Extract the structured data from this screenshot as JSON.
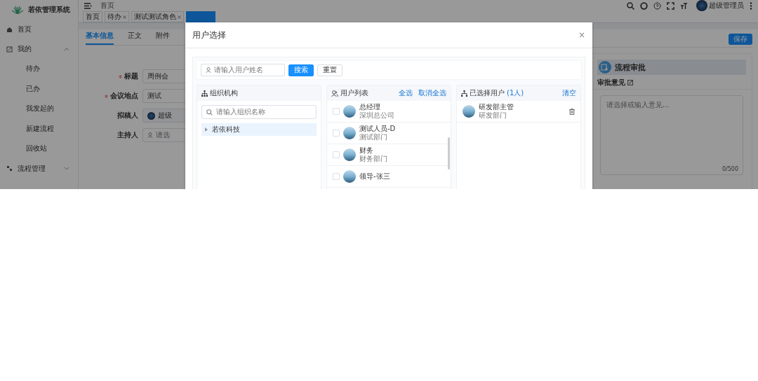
{
  "app": {
    "title": "若依管理系统"
  },
  "sidebar": {
    "items": [
      {
        "label": "首页"
      },
      {
        "label": "我的",
        "expanded": true,
        "children": [
          {
            "label": "待办"
          },
          {
            "label": "已办"
          },
          {
            "label": "我发起的"
          },
          {
            "label": "新建流程"
          },
          {
            "label": "回收站"
          }
        ]
      },
      {
        "label": "流程管理",
        "expanded": false
      }
    ]
  },
  "header": {
    "breadcrumb": "首页",
    "user": "超级管理员"
  },
  "tags": [
    {
      "label": "首页",
      "closable": false
    },
    {
      "label": "待办",
      "closable": true
    },
    {
      "label": "测试测试角色",
      "closable": true
    }
  ],
  "tabs": [
    {
      "label": "基本信息",
      "selected": true
    },
    {
      "label": "正文",
      "selected": false
    },
    {
      "label": "附件",
      "selected": false
    }
  ],
  "form": [
    {
      "label": "标题",
      "required": true,
      "kind": "text",
      "value": "周例会"
    },
    {
      "label": "会议地点",
      "required": true,
      "kind": "text",
      "value": "测试"
    },
    {
      "label": "拟稿人",
      "required": false,
      "kind": "user",
      "value": "超级"
    },
    {
      "label": "主持人",
      "required": false,
      "kind": "picker",
      "placeholder": "请选"
    }
  ],
  "save_button": "保存",
  "approval": {
    "title": "流程审批",
    "opinion_label": "审批意见",
    "placeholder": "请选择或输入意见...",
    "counter": "0/500"
  },
  "dialog": {
    "title": "用户选择",
    "close": "×",
    "search_placeholder": "请输入用户姓名",
    "search_button": "搜索",
    "reset_button": "重置",
    "org": {
      "title": "组织机构",
      "search_placeholder": "请输入组织名称",
      "tree": [
        {
          "label": "若依科技",
          "expanded": false,
          "selected": true
        }
      ]
    },
    "users": {
      "title": "用户列表",
      "select_all": "全选",
      "deselect_all": "取消全选",
      "items": [
        {
          "name": "总经理",
          "dept": "深圳总公司",
          "checked": false
        },
        {
          "name": "测试人员-D",
          "dept": "测试部门",
          "checked": false
        },
        {
          "name": "财务",
          "dept": "财务部门",
          "checked": false
        },
        {
          "name": "领导-张三",
          "checked": false
        }
      ]
    },
    "selected": {
      "title": "已选择用户",
      "count": "(1人)",
      "clear": "清空",
      "items": [
        {
          "name": "研发部主管",
          "dept": "研发部门"
        }
      ]
    }
  }
}
